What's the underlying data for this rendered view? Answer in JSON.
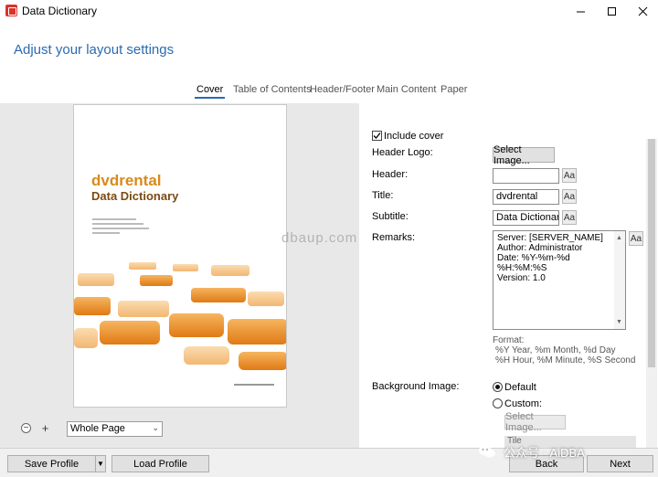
{
  "window": {
    "title": "Data Dictionary"
  },
  "heading": "Adjust your layout settings",
  "tabs": [
    {
      "label": "Cover",
      "active": true
    },
    {
      "label": "Table of Contents",
      "active": false
    },
    {
      "label": "Header/Footer",
      "active": false
    },
    {
      "label": "Main Content",
      "active": false
    },
    {
      "label": "Paper",
      "active": false
    }
  ],
  "preview": {
    "title": "dvdrental",
    "subtitle": "Data Dictionary"
  },
  "zoom": {
    "selected": "Whole Page"
  },
  "cover": {
    "include_cover_label": "Include cover",
    "include_cover_checked": true,
    "header_logo_label": "Header Logo:",
    "select_image_label": "Select Image...",
    "header_label": "Header:",
    "header_value": "",
    "title_label": "Title:",
    "title_value": "dvdrental",
    "subtitle_label": "Subtitle:",
    "subtitle_value": "Data Dictionary",
    "remarks_label": "Remarks:",
    "remarks_lines": [
      "Server: [SERVER_NAME]",
      "Author: Administrator",
      "Date: %Y-%m-%d %H:%M:%S",
      "Version: 1.0"
    ],
    "font_button_label": "Aa",
    "format_lines": [
      "Format:",
      "%Y Year, %m Month, %d Day",
      "%H Hour, %M Minute, %S Second"
    ],
    "background_label": "Background Image:",
    "bg_default_label": "Default",
    "bg_custom_label": "Custom:",
    "bg_select_label": "Select Image...",
    "bg_selected": "Default",
    "clipped_field": "Tile"
  },
  "footer": {
    "save_profile": "Save Profile",
    "load_profile": "Load Profile",
    "back": "Back",
    "next": "Next"
  },
  "overlays": {
    "watermark": "dbaup.com",
    "wechat": "公众号 · AiDBA"
  },
  "colors": {
    "accent": "#2a6ab0",
    "cover_orange": "#d88a1c",
    "cover_brown": "#7b4a12"
  }
}
